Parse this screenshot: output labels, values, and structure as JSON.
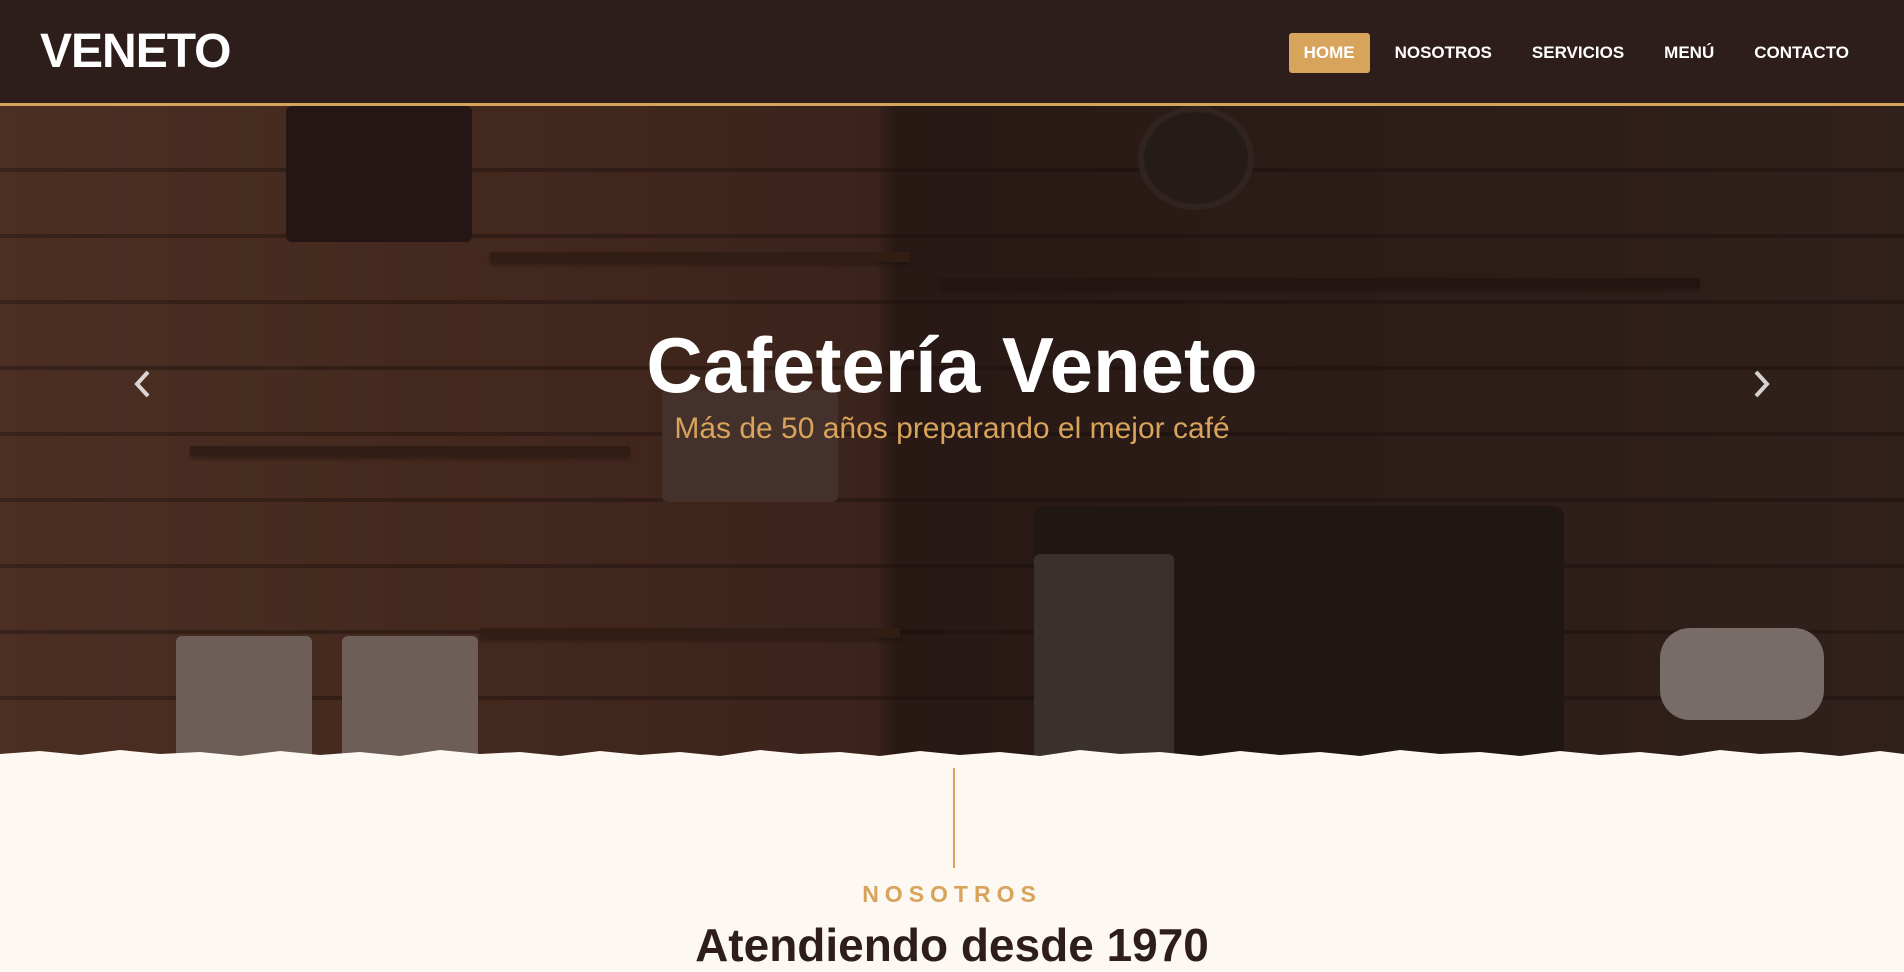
{
  "brand": {
    "name": "VENETO"
  },
  "nav": {
    "items": [
      {
        "label": "HOME",
        "active": true
      },
      {
        "label": "NOSOTROS",
        "active": false
      },
      {
        "label": "SERVICIOS",
        "active": false
      },
      {
        "label": "MENÚ",
        "active": false
      },
      {
        "label": "CONTACTO",
        "active": false
      }
    ]
  },
  "hero": {
    "title": "Cafetería Veneto",
    "subtitle": "Más de 50 años preparando el mejor café",
    "prev_icon": "chevron-left-icon",
    "next_icon": "chevron-right-icon"
  },
  "about": {
    "eyebrow": "NOSOTROS",
    "title": "Atendiendo desde 1970"
  },
  "colors": {
    "nav_bg": "#2e1e1b",
    "accent": "#d8a35a",
    "page_bg": "#fdf8f1",
    "heading": "#2e1e1b"
  }
}
